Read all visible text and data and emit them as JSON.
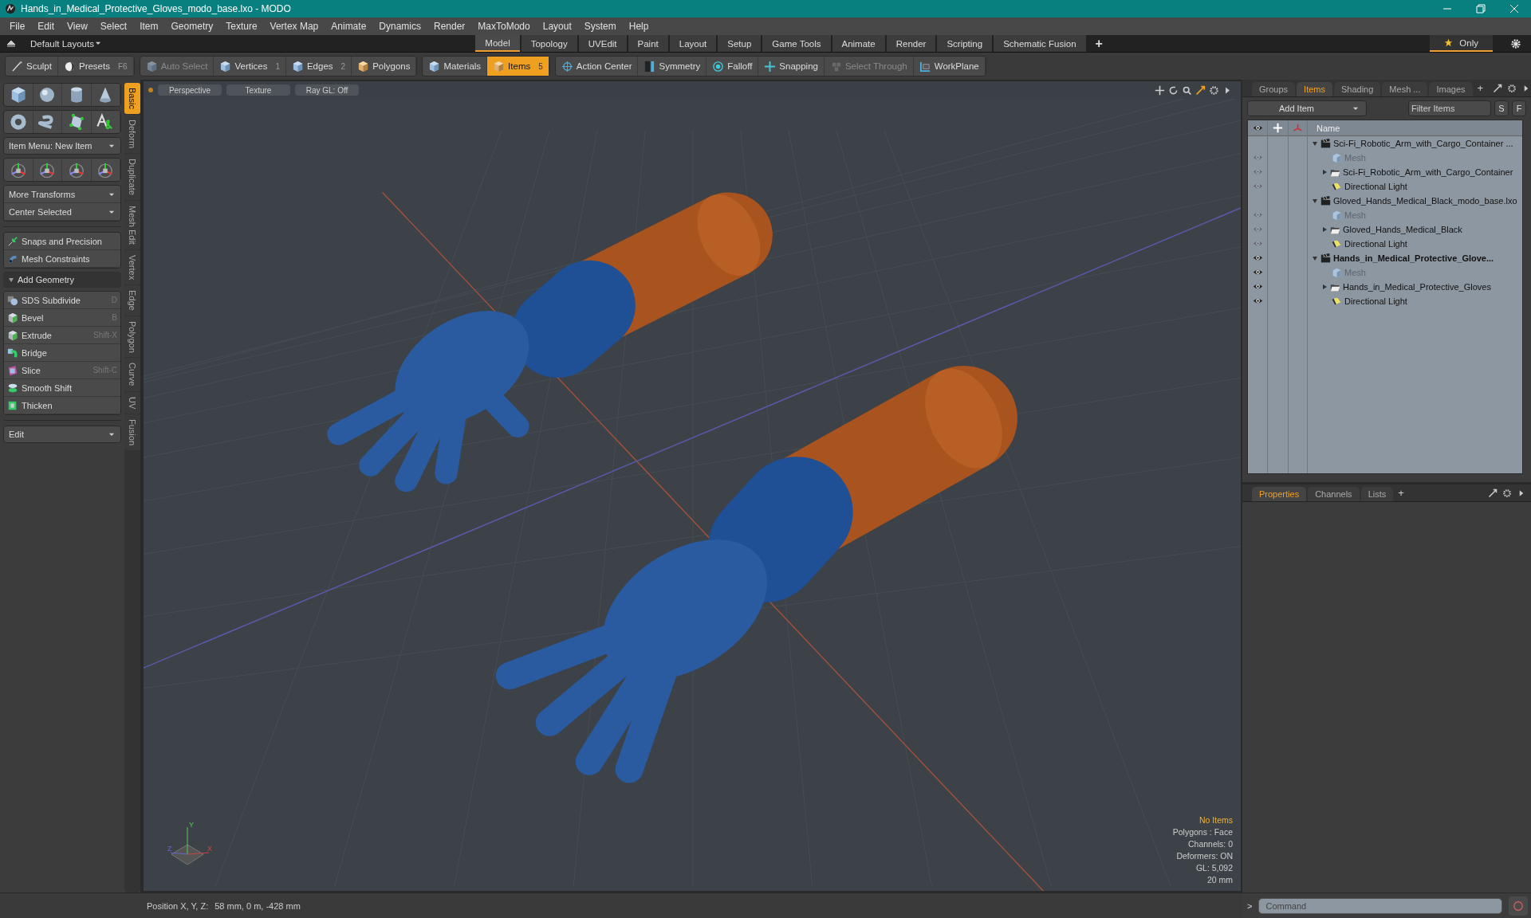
{
  "window": {
    "title": "Hands_in_Medical_Protective_Gloves_modo_base.lxo - MODO"
  },
  "menu": [
    "File",
    "Edit",
    "View",
    "Select",
    "Item",
    "Geometry",
    "Texture",
    "Vertex Map",
    "Animate",
    "Dynamics",
    "Render",
    "MaxToModo",
    "Layout",
    "System",
    "Help"
  ],
  "layout_bar": {
    "layouts": "Default Layouts",
    "tabs": [
      {
        "label": "Model",
        "selected": true
      },
      {
        "label": "Topology",
        "selected": false
      },
      {
        "label": "UVEdit",
        "selected": false
      },
      {
        "label": "Paint",
        "selected": false
      },
      {
        "label": "Layout",
        "selected": false
      },
      {
        "label": "Setup",
        "selected": false
      },
      {
        "label": "Game Tools",
        "selected": false
      },
      {
        "label": "Animate",
        "selected": false
      },
      {
        "label": "Render",
        "selected": false
      },
      {
        "label": "Scripting",
        "selected": false
      },
      {
        "label": "Schematic Fusion",
        "selected": false
      }
    ],
    "add": "+",
    "only": "Only"
  },
  "toolbar": {
    "groups": [
      [
        {
          "label": "Sculpt",
          "selected": false,
          "disabled": false
        },
        {
          "label": "Presets",
          "shortcut": "F6",
          "selected": false,
          "disabled": false
        }
      ],
      [
        {
          "label": "Auto Select",
          "selected": false,
          "disabled": true
        },
        {
          "label": "Vertices",
          "shortcut": "1",
          "selected": false,
          "disabled": false
        },
        {
          "label": "Edges",
          "shortcut": "2",
          "selected": false,
          "disabled": false
        },
        {
          "label": "Polygons",
          "selected": false,
          "disabled": false
        }
      ],
      [
        {
          "label": "Materials",
          "selected": false,
          "disabled": false
        },
        {
          "label": "Items",
          "shortcut": "5",
          "selected": true,
          "disabled": false
        }
      ],
      [
        {
          "label": "Action Center",
          "selected": false,
          "disabled": false
        },
        {
          "label": "Symmetry",
          "selected": false,
          "disabled": false
        },
        {
          "label": "Falloff",
          "selected": false,
          "disabled": false
        },
        {
          "label": "Snapping",
          "selected": false,
          "disabled": false
        },
        {
          "label": "Select Through",
          "selected": false,
          "disabled": true
        },
        {
          "label": "WorkPlane",
          "selected": false,
          "disabled": false
        }
      ]
    ]
  },
  "left_panel": {
    "item_menu": "Item Menu: New Item",
    "dropdowns": [
      "More Transforms",
      "Center Selected"
    ],
    "constraints": [
      "Snaps and Precision",
      "Mesh Constraints"
    ],
    "section": {
      "label": "Add Geometry",
      "expanded": true,
      "tools": [
        {
          "label": "SDS Subdivide",
          "shortcut": "D"
        },
        {
          "label": "Bevel",
          "shortcut": "B"
        },
        {
          "label": "Extrude",
          "shortcut": "Shift-X"
        },
        {
          "label": "Bridge"
        },
        {
          "label": "Slice",
          "shortcut": "Shift-C"
        },
        {
          "label": "Smooth Shift"
        },
        {
          "label": "Thicken"
        }
      ]
    },
    "edit": "Edit",
    "side_tabs": [
      {
        "label": "Basic",
        "selected": true
      },
      {
        "label": "Deform",
        "selected": false
      },
      {
        "label": "Duplicate",
        "selected": false
      },
      {
        "label": "Mesh Edit",
        "selected": false
      },
      {
        "label": "Vertex",
        "selected": false
      },
      {
        "label": "Edge",
        "selected": false
      },
      {
        "label": "Polygon",
        "selected": false
      },
      {
        "label": "Curve",
        "selected": false
      },
      {
        "label": "UV",
        "selected": false
      },
      {
        "label": "Fusion",
        "selected": false
      }
    ]
  },
  "viewport": {
    "view_buttons": [
      "Perspective",
      "Texture",
      "Ray GL: Off"
    ],
    "gizmo_labels": [
      "Y",
      "Z",
      "X"
    ],
    "info": [
      {
        "text": "No Items",
        "kind": "highlight"
      },
      {
        "text": "Polygons : Face",
        "kind": "normal"
      },
      {
        "text": "Channels: 0",
        "kind": "normal"
      },
      {
        "text": "Deformers: ON",
        "kind": "normal"
      },
      {
        "text": "GL: 5,092",
        "kind": "normal"
      },
      {
        "text": "20 mm",
        "kind": "normal"
      }
    ]
  },
  "items_panel": {
    "tabs": [
      {
        "label": "Groups",
        "selected": false
      },
      {
        "label": "Items",
        "selected": true
      },
      {
        "label": "Shading",
        "selected": false
      },
      {
        "label": "Mesh ...",
        "selected": false
      },
      {
        "label": "Images",
        "selected": false
      }
    ],
    "add": "+",
    "add_item": "Add Item",
    "filter_placeholder": "Filter Items",
    "buttons": [
      "S",
      "F"
    ],
    "column": "Name",
    "scenes": [
      {
        "label": "Sci-Fi_Robotic_Arm_with_Cargo_Container ...",
        "active": false,
        "expanded": true,
        "visible": false,
        "children": [
          {
            "label": "Mesh",
            "kind": "mesh",
            "disabled": true,
            "visible": false
          },
          {
            "label": "Sci-Fi_Robotic_Arm_with_Cargo_Container",
            "kind": "group",
            "disabled": false,
            "expanded": false,
            "visible": false
          },
          {
            "label": "Directional Light",
            "kind": "light",
            "disabled": false,
            "visible": false
          }
        ]
      },
      {
        "label": "Gloved_Hands_Medical_Black_modo_base.lxo",
        "active": false,
        "expanded": true,
        "visible": false,
        "children": [
          {
            "label": "Mesh",
            "kind": "mesh",
            "disabled": true,
            "visible": false
          },
          {
            "label": "Gloved_Hands_Medical_Black",
            "kind": "group",
            "disabled": false,
            "expanded": false,
            "visible": false
          },
          {
            "label": "Directional Light",
            "kind": "light",
            "disabled": false,
            "visible": false
          }
        ]
      },
      {
        "label": "Hands_in_Medical_Protective_Glove...",
        "active": true,
        "expanded": true,
        "visible": true,
        "children": [
          {
            "label": "Mesh",
            "kind": "mesh",
            "disabled": true,
            "visible": true
          },
          {
            "label": "Hands_in_Medical_Protective_Gloves",
            "kind": "group",
            "disabled": false,
            "expanded": false,
            "visible": true
          },
          {
            "label": "Directional Light",
            "kind": "light",
            "disabled": false,
            "visible": true
          }
        ]
      }
    ]
  },
  "properties_panel": {
    "tabs": [
      {
        "label": "Properties",
        "selected": true
      },
      {
        "label": "Channels",
        "selected": false
      },
      {
        "label": "Lists",
        "selected": false
      }
    ],
    "add": "+",
    "prompt": ">",
    "command_placeholder": "Command"
  },
  "status_bar": {
    "label": "Position X, Y, Z:",
    "value": "58 mm, 0 m, -428 mm"
  }
}
